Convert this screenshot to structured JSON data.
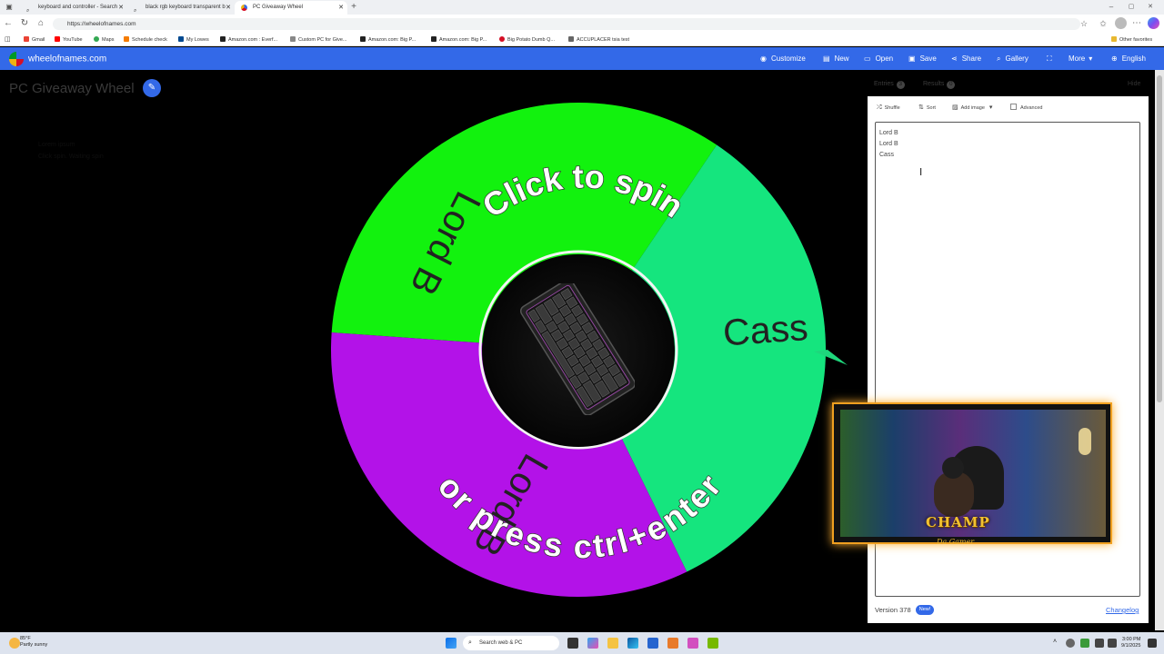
{
  "browser": {
    "tabs": [
      {
        "label": "keyboard and controller - Search",
        "active": false
      },
      {
        "label": "black rgb keyboard transparent b",
        "active": false
      },
      {
        "label": "PC Giveaway Wheel",
        "active": true
      }
    ],
    "url": "https://wheelofnames.com",
    "bookmarks": [
      "Gmail",
      "YouTube",
      "Maps",
      "Schedule check",
      "My Lowes",
      "Amazon.com : Everf...",
      "Custom PC for Give...",
      "Amazon.com: Big P...",
      "Amazon.com: Big P...",
      "Big Potato Dumb Q...",
      "ACCUPLACER tsia test"
    ],
    "other_favorites": "Other favorites"
  },
  "app": {
    "site_name": "wheelofnames.com",
    "nav": [
      "Customize",
      "New",
      "Open",
      "Save",
      "Share",
      "Gallery",
      "",
      "More",
      "English"
    ],
    "brand_color": "#3369e8"
  },
  "wheel": {
    "title": "PC Giveaway Wheel",
    "center_text_top": "Click to spin",
    "center_text_bottom": "or press ctrl+enter",
    "segments": [
      {
        "label": "Lord B",
        "color": "#12f20e"
      },
      {
        "label": "Cass",
        "color": "#15e57e"
      },
      {
        "label": "Lord B",
        "color": "#b312e8"
      }
    ],
    "pointer_color": "#1fd67c",
    "ghost_text": [
      "Lorem ipsum",
      "Click spin. Waiting spin"
    ]
  },
  "panel": {
    "tabs": [
      {
        "label": "Entries",
        "count": "3"
      },
      {
        "label": "Results",
        "count": "0"
      }
    ],
    "hide_label": "Hide",
    "toolbar": [
      "Shuffle",
      "Sort",
      "Add image"
    ],
    "advanced_label": "Advanced",
    "entries": [
      "Lord B",
      "Lord B",
      "Cass"
    ],
    "version": "Version 378",
    "new_badge": "New!",
    "changelog": "Changelog"
  },
  "overlay": {
    "brand_text": "CHAMP",
    "sub_text": "Da Gamer"
  },
  "taskbar": {
    "temperature": "85°F",
    "weather": "Partly sunny",
    "search": "Search web & PC",
    "time": "3:00 PM",
    "date": "9/1/2025"
  }
}
